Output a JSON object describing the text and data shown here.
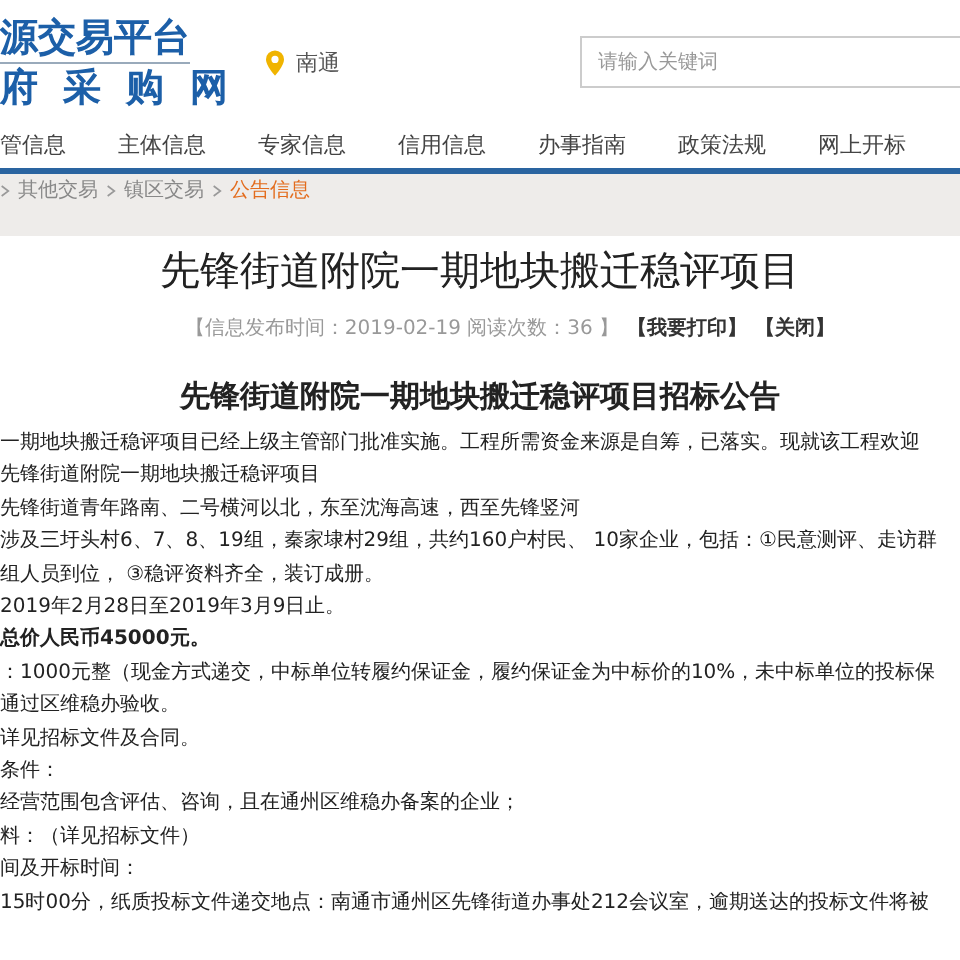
{
  "logo": {
    "line_1": "源交易平台",
    "line_2": "府 采 购 网"
  },
  "location": "南通",
  "search": {
    "placeholder": "请输入关键词"
  },
  "nav": [
    "管信息",
    "主体信息",
    "专家信息",
    "信用信息",
    "办事指南",
    "政策法规",
    "网上开标"
  ],
  "breadcrumb": [
    {
      "label": "其他交易",
      "current": false
    },
    {
      "label": "镇区交易",
      "current": false
    },
    {
      "label": "公告信息",
      "current": true
    }
  ],
  "article": {
    "title": "先锋街道附院一期地块搬迁稳评项目",
    "meta": "【信息发布时间：2019-02-19 阅读次数：36 】",
    "actions": [
      "【我要打印】",
      "【关闭】"
    ],
    "subtitle": "先锋街道附院一期地块搬迁稳评项目招标公告",
    "lines": [
      {
        "text": "一期地块搬迁稳评项目已经上级主管部门批准实施。工程所需资金来源是自筹，已落实。现就该工程欢迎",
        "bold": false
      },
      {
        "text": "先锋街道附院一期地块搬迁稳评项目",
        "bold": false
      },
      {
        "text": "先锋街道青年路南、二号横河以北，东至沈海高速，西至先锋竖河",
        "bold": false
      },
      {
        "text": "涉及三圩头村6、7、8、19组，秦家埭村29组，共约160户村民、 10家企业，包括：①民意测评、走访群",
        "bold": false
      },
      {
        "text": "组人员到位， ③稳评资料齐全，装订成册。",
        "bold": false
      },
      {
        "text": "2019年2月28日至2019年3月9日止。",
        "bold": false
      },
      {
        "text": "总价人民币45000元。",
        "bold": true
      },
      {
        "text": "：1000元整（现金方式递交，中标单位转履约保证金，履约保证金为中标价的10%，未中标单位的投标保",
        "bold": false
      },
      {
        "text": "通过区维稳办验收。",
        "bold": false
      },
      {
        "text": "详见招标文件及合同。",
        "bold": false
      },
      {
        "text": "条件：",
        "bold": false
      },
      {
        "text": "经营范围包含评估、咨询，且在通州区维稳办备案的企业；",
        "bold": false
      },
      {
        "text": "料：（详见招标文件）",
        "bold": false
      },
      {
        "text": "间及开标时间：",
        "bold": false
      },
      {
        "text": "15时00分，纸质投标文件递交地点：南通市通州区先锋街道办事处212会议室，逾期送达的投标文件将被",
        "bold": false
      }
    ]
  }
}
